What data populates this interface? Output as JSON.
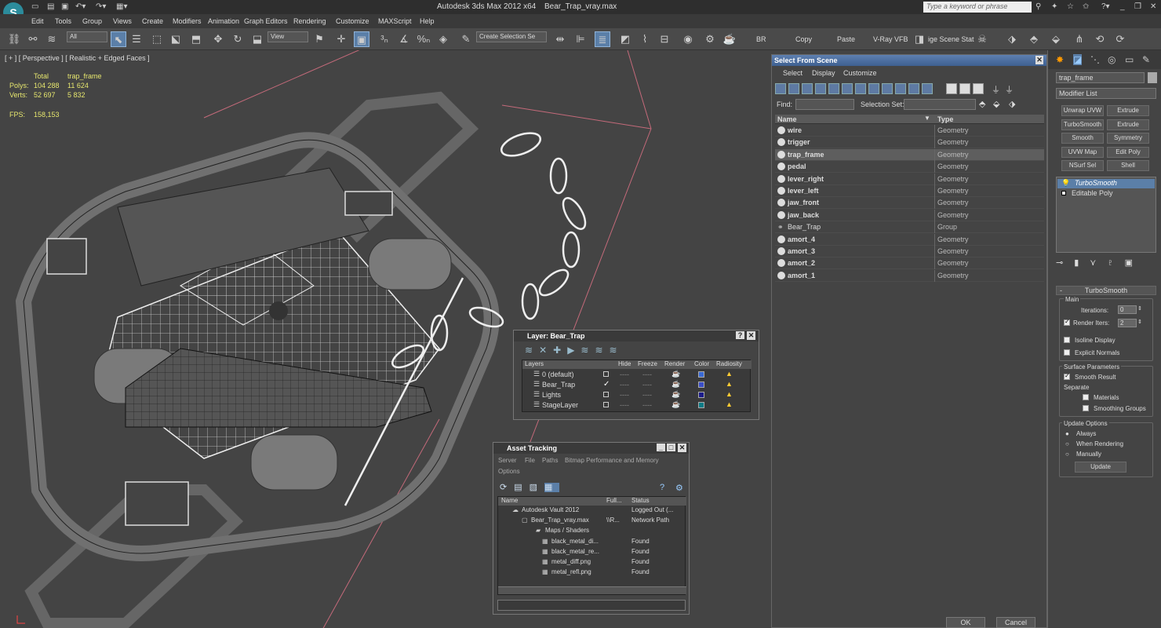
{
  "app": {
    "title": "Autodesk 3ds Max  2012 x64",
    "file": "Bear_Trap_vray.max",
    "search_placeholder": "Type a keyword or phrase"
  },
  "menu": [
    "Edit",
    "Tools",
    "Group",
    "Views",
    "Create",
    "Modifiers",
    "Animation",
    "Graph Editors",
    "Rendering",
    "Customize",
    "MAXScript",
    "Help"
  ],
  "toolbar": {
    "filter": "All",
    "view": "View",
    "selset_placeholder": "Create Selection Se",
    "br": "BR",
    "copy": "Copy",
    "paste": "Paste",
    "vray": "V-Ray VFB",
    "scene_state": "ige Scene Stat"
  },
  "viewport": {
    "label": "[ + ] [ Perspective ] [ Realistic + Edged Faces ]",
    "stats": {
      "total": "Total",
      "obj": "trap_frame",
      "polys_lbl": "Polys:",
      "polys_total": "104 288",
      "polys_obj": "11 624",
      "verts_lbl": "Verts:",
      "verts_total": "52 697",
      "verts_obj": "5 832",
      "fps_lbl": "FPS:",
      "fps": "158,153"
    }
  },
  "sfs": {
    "title": "Select From Scene",
    "menu": [
      "Select",
      "Display",
      "Customize"
    ],
    "find": "Find:",
    "selset": "Selection Set:",
    "col_name": "Name",
    "col_type": "Type",
    "rows": [
      {
        "name": "wire",
        "type": "Geometry",
        "bold": true
      },
      {
        "name": "trigger",
        "type": "Geometry",
        "bold": true
      },
      {
        "name": "trap_frame",
        "type": "Geometry",
        "bold": true,
        "sel": true
      },
      {
        "name": "pedal",
        "type": "Geometry",
        "bold": true
      },
      {
        "name": "lever_right",
        "type": "Geometry",
        "bold": true
      },
      {
        "name": "lever_left",
        "type": "Geometry",
        "bold": true
      },
      {
        "name": "jaw_front",
        "type": "Geometry",
        "bold": true
      },
      {
        "name": "jaw_back",
        "type": "Geometry",
        "bold": true
      },
      {
        "name": "Bear_Trap",
        "type": "Group",
        "bold": false
      },
      {
        "name": "amort_4",
        "type": "Geometry",
        "bold": true
      },
      {
        "name": "amort_3",
        "type": "Geometry",
        "bold": true
      },
      {
        "name": "amort_2",
        "type": "Geometry",
        "bold": true
      },
      {
        "name": "amort_1",
        "type": "Geometry",
        "bold": true
      }
    ],
    "ok": "OK",
    "cancel": "Cancel"
  },
  "cmd": {
    "obj_name": "trap_frame",
    "modlist": "Modifier List",
    "buttons": [
      "Unwrap UVW",
      "Extrude",
      "TurboSmooth",
      "Extrude",
      "Smooth",
      "Symmetry",
      "UVW Map",
      "Edit Poly",
      "NSurf Sel",
      "Shell"
    ],
    "stack": [
      "TurboSmooth",
      "Editable Poly"
    ],
    "rollout": "TurboSmooth",
    "main": "Main",
    "iterations": "Iterations:",
    "iter_val": "0",
    "render_iters": "Render Iters:",
    "render_val": "2",
    "isoline": "Isoline Display",
    "explicit": "Explicit Normals",
    "surface": "Surface Parameters",
    "smooth_result": "Smooth Result",
    "separate": "Separate",
    "materials": "Materials",
    "smoothing_groups": "Smoothing Groups",
    "update_opts": "Update Options",
    "always": "Always",
    "when_rendering": "When Rendering",
    "manually": "Manually",
    "update": "Update"
  },
  "layer": {
    "title": "Layer: Bear_Trap",
    "cols": [
      "Layers",
      "Hide",
      "Freeze",
      "Render",
      "Color",
      "Radiosity"
    ],
    "rows": [
      {
        "name": "0 (default)",
        "color": "#3a6ad6"
      },
      {
        "name": "Bear_Trap",
        "color": "#3b4fc9"
      },
      {
        "name": "Lights",
        "color": "#1c1c8a"
      },
      {
        "name": "StageLayer",
        "color": "#0d7b86"
      }
    ]
  },
  "asset": {
    "title": "Asset Tracking",
    "menu1": [
      "Server",
      "File",
      "Paths",
      "Bitmap Performance and Memory"
    ],
    "menu2": "Options",
    "cols": [
      "Name",
      "Full...",
      "Status"
    ],
    "rows": [
      {
        "name": "Autodesk Vault 2012",
        "full": "",
        "status": "Logged Out (...",
        "indent": 0
      },
      {
        "name": "Bear_Trap_vray.max",
        "full": "\\\\R...",
        "status": "Network Path",
        "indent": 1
      },
      {
        "name": "Maps / Shaders",
        "full": "",
        "status": "",
        "indent": 2
      },
      {
        "name": "black_metal_di...",
        "full": "",
        "status": "Found",
        "indent": 3
      },
      {
        "name": "black_metal_re...",
        "full": "",
        "status": "Found",
        "indent": 3
      },
      {
        "name": "metal_diff.png",
        "full": "",
        "status": "Found",
        "indent": 3
      },
      {
        "name": "metal_refl.png",
        "full": "",
        "status": "Found",
        "indent": 3
      }
    ]
  }
}
